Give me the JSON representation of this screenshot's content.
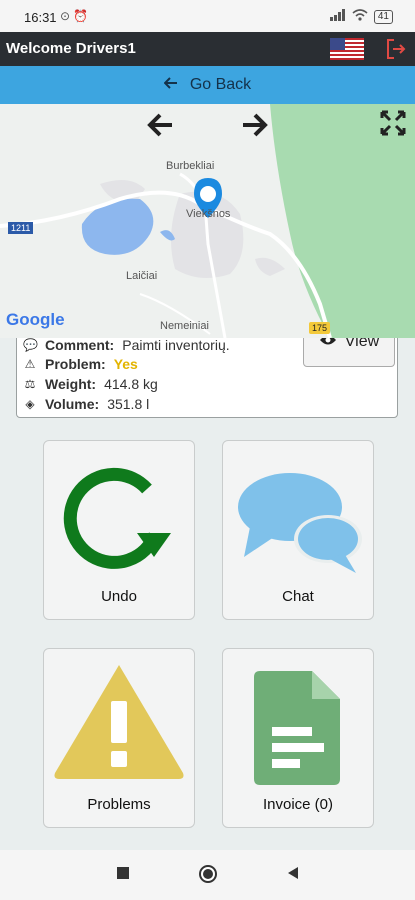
{
  "status": {
    "time": "16:31",
    "battery": "41"
  },
  "header": {
    "title": "Welcome Drivers1"
  },
  "nav": {
    "go_back": "Go Back"
  },
  "map": {
    "labels": {
      "burbekliai": "Burbekliai",
      "vieksnos": "Viekšnos",
      "laiciai": "Laičiai",
      "nemeiniai": "Nemeiniai",
      "road1": "1211",
      "road2": "175"
    },
    "google": "Google"
  },
  "order": {
    "comment_label": "Comment:",
    "comment_value": "Paimti inventorių.",
    "problem_label": "Problem:",
    "problem_value": "Yes",
    "weight_label": "Weight:",
    "weight_value": "414.8 kg",
    "volume_label": "Volume:",
    "volume_value": "351.8 l",
    "view_label": "View"
  },
  "colors": {
    "accent": "#3da5e0",
    "undo": "#0f7a1c",
    "chat": "#7fc1ea",
    "problems": "#e2c85a",
    "invoice": "#6fae77",
    "problem_yes": "#e3b400"
  },
  "actions": [
    {
      "label": "Undo",
      "icon": "undo-icon"
    },
    {
      "label": "Chat",
      "icon": "chat-icon"
    },
    {
      "label": "Problems",
      "icon": "warning-icon"
    },
    {
      "label": "Invoice (0)",
      "icon": "invoice-icon"
    }
  ]
}
